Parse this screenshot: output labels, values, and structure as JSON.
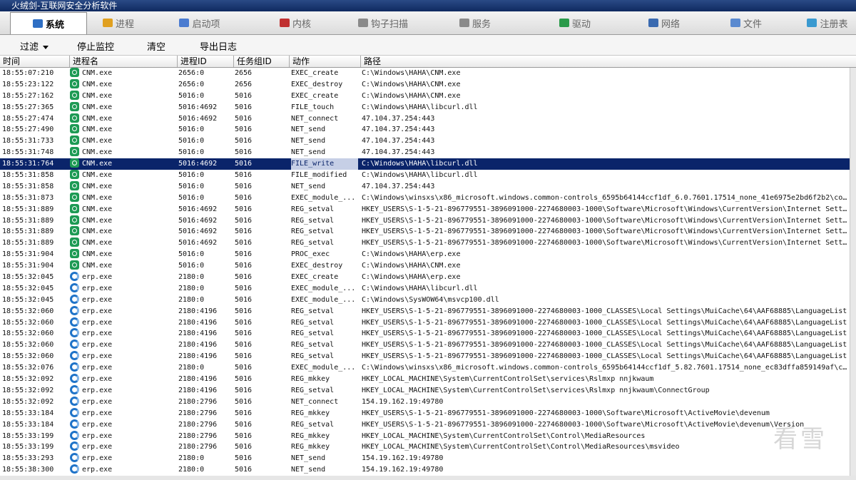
{
  "window": {
    "title": "火绒剑-互联网安全分析软件"
  },
  "tabs": [
    {
      "label": "系统",
      "icon": "monitor-icon",
      "color": "#2f6fc4"
    },
    {
      "label": "进程",
      "icon": "process-icon",
      "color": "#e0a020"
    },
    {
      "label": "启动项",
      "icon": "startup-icon",
      "color": "#4a7bd0"
    },
    {
      "label": "内核",
      "icon": "kernel-icon",
      "color": "#c03030"
    },
    {
      "label": "钩子扫描",
      "icon": "hook-icon",
      "color": "#8a8a8a"
    },
    {
      "label": "服务",
      "icon": "service-icon",
      "color": "#8a8a8a"
    },
    {
      "label": "驱动",
      "icon": "driver-icon",
      "color": "#2a9a4a"
    },
    {
      "label": "网络",
      "icon": "network-icon",
      "color": "#3a6ab0"
    },
    {
      "label": "文件",
      "icon": "file-icon",
      "color": "#5a8ad0"
    },
    {
      "label": "注册表",
      "icon": "registry-icon",
      "color": "#3a9ad0"
    }
  ],
  "toolbar": {
    "filter_label": "过滤",
    "stop_label": "停止监控",
    "clear_label": "清空",
    "export_label": "导出日志"
  },
  "columns": {
    "time": "时间",
    "process": "进程名",
    "pid": "进程ID",
    "task": "任务组ID",
    "action": "动作",
    "path": "路径"
  },
  "selected_row_index": 8,
  "rows": [
    {
      "time": "18:55:07:210",
      "proc": "CNM.exe",
      "icon": "green",
      "pid": "2656:0",
      "task": "2656",
      "action": "EXEC_create",
      "path": "C:\\Windows\\HAHA\\CNM.exe"
    },
    {
      "time": "18:55:23:122",
      "proc": "CNM.exe",
      "icon": "green",
      "pid": "2656:0",
      "task": "2656",
      "action": "EXEC_destroy",
      "path": "C:\\Windows\\HAHA\\CNM.exe"
    },
    {
      "time": "18:55:27:162",
      "proc": "CNM.exe",
      "icon": "green",
      "pid": "5016:0",
      "task": "5016",
      "action": "EXEC_create",
      "path": "C:\\Windows\\HAHA\\CNM.exe"
    },
    {
      "time": "18:55:27:365",
      "proc": "CNM.exe",
      "icon": "green",
      "pid": "5016:4692",
      "task": "5016",
      "action": "FILE_touch",
      "path": "C:\\Windows\\HAHA\\libcurl.dll"
    },
    {
      "time": "18:55:27:474",
      "proc": "CNM.exe",
      "icon": "green",
      "pid": "5016:4692",
      "task": "5016",
      "action": "NET_connect",
      "path": "47.104.37.254:443"
    },
    {
      "time": "18:55:27:490",
      "proc": "CNM.exe",
      "icon": "green",
      "pid": "5016:0",
      "task": "5016",
      "action": "NET_send",
      "path": "47.104.37.254:443"
    },
    {
      "time": "18:55:31:733",
      "proc": "CNM.exe",
      "icon": "green",
      "pid": "5016:0",
      "task": "5016",
      "action": "NET_send",
      "path": "47.104.37.254:443"
    },
    {
      "time": "18:55:31:748",
      "proc": "CNM.exe",
      "icon": "green",
      "pid": "5016:0",
      "task": "5016",
      "action": "NET_send",
      "path": "47.104.37.254:443"
    },
    {
      "time": "18:55:31:764",
      "proc": "CNM.exe",
      "icon": "green",
      "pid": "5016:4692",
      "task": "5016",
      "action": "FILE_write",
      "path": "C:\\Windows\\HAHA\\libcurl.dll"
    },
    {
      "time": "18:55:31:858",
      "proc": "CNM.exe",
      "icon": "green",
      "pid": "5016:0",
      "task": "5016",
      "action": "FILE_modified",
      "path": "C:\\Windows\\HAHA\\libcurl.dll"
    },
    {
      "time": "18:55:31:858",
      "proc": "CNM.exe",
      "icon": "green",
      "pid": "5016:0",
      "task": "5016",
      "action": "NET_send",
      "path": "47.104.37.254:443"
    },
    {
      "time": "18:55:31:873",
      "proc": "CNM.exe",
      "icon": "green",
      "pid": "5016:0",
      "task": "5016",
      "action": "EXEC_module_...",
      "path": "C:\\Windows\\winsxs\\x86_microsoft.windows.common-controls_6595b64144ccf1df_6.0.7601.17514_none_41e6975e2bd6f2b2\\co..."
    },
    {
      "time": "18:55:31:889",
      "proc": "CNM.exe",
      "icon": "green",
      "pid": "5016:4692",
      "task": "5016",
      "action": "REG_setval",
      "path": "HKEY_USERS\\S-1-5-21-896779551-3896091000-2274680003-1000\\Software\\Microsoft\\Windows\\CurrentVersion\\Internet Sett..."
    },
    {
      "time": "18:55:31:889",
      "proc": "CNM.exe",
      "icon": "green",
      "pid": "5016:4692",
      "task": "5016",
      "action": "REG_setval",
      "path": "HKEY_USERS\\S-1-5-21-896779551-3896091000-2274680003-1000\\Software\\Microsoft\\Windows\\CurrentVersion\\Internet Sett..."
    },
    {
      "time": "18:55:31:889",
      "proc": "CNM.exe",
      "icon": "green",
      "pid": "5016:4692",
      "task": "5016",
      "action": "REG_setval",
      "path": "HKEY_USERS\\S-1-5-21-896779551-3896091000-2274680003-1000\\Software\\Microsoft\\Windows\\CurrentVersion\\Internet Sett..."
    },
    {
      "time": "18:55:31:889",
      "proc": "CNM.exe",
      "icon": "green",
      "pid": "5016:4692",
      "task": "5016",
      "action": "REG_setval",
      "path": "HKEY_USERS\\S-1-5-21-896779551-3896091000-2274680003-1000\\Software\\Microsoft\\Windows\\CurrentVersion\\Internet Sett..."
    },
    {
      "time": "18:55:31:904",
      "proc": "CNM.exe",
      "icon": "green",
      "pid": "5016:0",
      "task": "5016",
      "action": "PROC_exec",
      "path": "C:\\Windows\\HAHA\\erp.exe"
    },
    {
      "time": "18:55:31:904",
      "proc": "CNM.exe",
      "icon": "green",
      "pid": "5016:0",
      "task": "5016",
      "action": "EXEC_destroy",
      "path": "C:\\Windows\\HAHA\\CNM.exe"
    },
    {
      "time": "18:55:32:045",
      "proc": "erp.exe",
      "icon": "blue",
      "pid": "2180:0",
      "task": "5016",
      "action": "EXEC_create",
      "path": "C:\\Windows\\HAHA\\erp.exe"
    },
    {
      "time": "18:55:32:045",
      "proc": "erp.exe",
      "icon": "blue",
      "pid": "2180:0",
      "task": "5016",
      "action": "EXEC_module_...",
      "path": "C:\\Windows\\HAHA\\libcurl.dll"
    },
    {
      "time": "18:55:32:045",
      "proc": "erp.exe",
      "icon": "blue",
      "pid": "2180:0",
      "task": "5016",
      "action": "EXEC_module_...",
      "path": "C:\\Windows\\SysWOW64\\msvcp100.dll"
    },
    {
      "time": "18:55:32:060",
      "proc": "erp.exe",
      "icon": "blue",
      "pid": "2180:4196",
      "task": "5016",
      "action": "REG_setval",
      "path": "HKEY_USERS\\S-1-5-21-896779551-3896091000-2274680003-1000_CLASSES\\Local Settings\\MuiCache\\64\\AAF68885\\LanguageList"
    },
    {
      "time": "18:55:32:060",
      "proc": "erp.exe",
      "icon": "blue",
      "pid": "2180:4196",
      "task": "5016",
      "action": "REG_setval",
      "path": "HKEY_USERS\\S-1-5-21-896779551-3896091000-2274680003-1000_CLASSES\\Local Settings\\MuiCache\\64\\AAF68885\\LanguageList"
    },
    {
      "time": "18:55:32:060",
      "proc": "erp.exe",
      "icon": "blue",
      "pid": "2180:4196",
      "task": "5016",
      "action": "REG_setval",
      "path": "HKEY_USERS\\S-1-5-21-896779551-3896091000-2274680003-1000_CLASSES\\Local Settings\\MuiCache\\64\\AAF68885\\LanguageList"
    },
    {
      "time": "18:55:32:060",
      "proc": "erp.exe",
      "icon": "blue",
      "pid": "2180:4196",
      "task": "5016",
      "action": "REG_setval",
      "path": "HKEY_USERS\\S-1-5-21-896779551-3896091000-2274680003-1000_CLASSES\\Local Settings\\MuiCache\\64\\AAF68885\\LanguageList"
    },
    {
      "time": "18:55:32:060",
      "proc": "erp.exe",
      "icon": "blue",
      "pid": "2180:4196",
      "task": "5016",
      "action": "REG_setval",
      "path": "HKEY_USERS\\S-1-5-21-896779551-3896091000-2274680003-1000_CLASSES\\Local Settings\\MuiCache\\64\\AAF68885\\LanguageList"
    },
    {
      "time": "18:55:32:076",
      "proc": "erp.exe",
      "icon": "blue",
      "pid": "2180:0",
      "task": "5016",
      "action": "EXEC_module_...",
      "path": "C:\\Windows\\winsxs\\x86_microsoft.windows.common-controls_6595b64144ccf1df_5.82.7601.17514_none_ec83dffa859149af\\c..."
    },
    {
      "time": "18:55:32:092",
      "proc": "erp.exe",
      "icon": "blue",
      "pid": "2180:4196",
      "task": "5016",
      "action": "REG_mkkey",
      "path": "HKEY_LOCAL_MACHINE\\System\\CurrentControlSet\\services\\Rslmxp nnjkwaum"
    },
    {
      "time": "18:55:32:092",
      "proc": "erp.exe",
      "icon": "blue",
      "pid": "2180:4196",
      "task": "5016",
      "action": "REG_setval",
      "path": "HKEY_LOCAL_MACHINE\\System\\CurrentControlSet\\services\\Rslmxp nnjkwaum\\ConnectGroup"
    },
    {
      "time": "18:55:32:092",
      "proc": "erp.exe",
      "icon": "blue",
      "pid": "2180:2796",
      "task": "5016",
      "action": "NET_connect",
      "path": "154.19.162.19:49780"
    },
    {
      "time": "18:55:33:184",
      "proc": "erp.exe",
      "icon": "blue",
      "pid": "2180:2796",
      "task": "5016",
      "action": "REG_mkkey",
      "path": "HKEY_USERS\\S-1-5-21-896779551-3896091000-2274680003-1000\\Software\\Microsoft\\ActiveMovie\\devenum"
    },
    {
      "time": "18:55:33:184",
      "proc": "erp.exe",
      "icon": "blue",
      "pid": "2180:2796",
      "task": "5016",
      "action": "REG_setval",
      "path": "HKEY_USERS\\S-1-5-21-896779551-3896091000-2274680003-1000\\Software\\Microsoft\\ActiveMovie\\devenum\\Version"
    },
    {
      "time": "18:55:33:199",
      "proc": "erp.exe",
      "icon": "blue",
      "pid": "2180:2796",
      "task": "5016",
      "action": "REG_mkkey",
      "path": "HKEY_LOCAL_MACHINE\\System\\CurrentControlSet\\Control\\MediaResources"
    },
    {
      "time": "18:55:33:199",
      "proc": "erp.exe",
      "icon": "blue",
      "pid": "2180:2796",
      "task": "5016",
      "action": "REG_mkkey",
      "path": "HKEY_LOCAL_MACHINE\\System\\CurrentControlSet\\Control\\MediaResources\\msvideo"
    },
    {
      "time": "18:55:33:293",
      "proc": "erp.exe",
      "icon": "blue",
      "pid": "2180:0",
      "task": "5016",
      "action": "NET_send",
      "path": "154.19.162.19:49780"
    },
    {
      "time": "18:55:38:300",
      "proc": "erp.exe",
      "icon": "blue",
      "pid": "2180:0",
      "task": "5016",
      "action": "NET_send",
      "path": "154.19.162.19:49780"
    }
  ],
  "watermark": {
    "text": "看雪"
  }
}
